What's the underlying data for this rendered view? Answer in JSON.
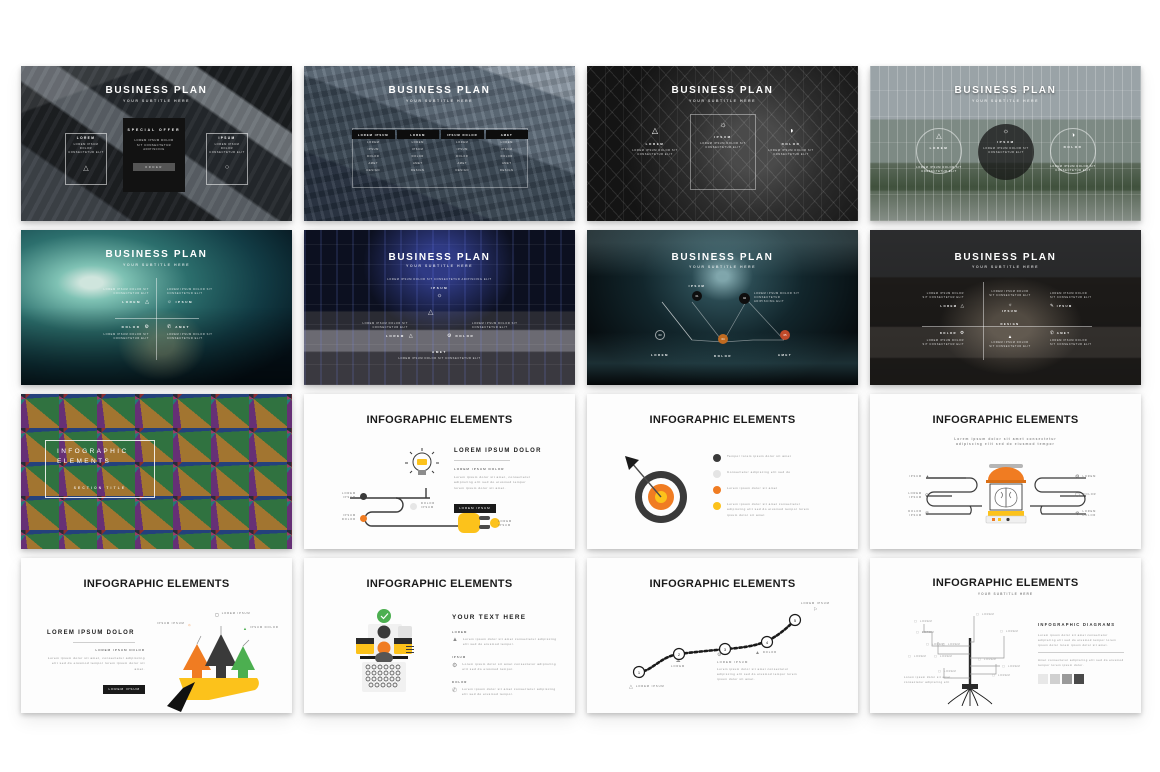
{
  "page": {
    "background": "#ffffff",
    "grid": {
      "rows": 4,
      "columns": 4,
      "total_slides": 16
    }
  },
  "palette": {
    "accent_orange": "#f07c22",
    "accent_yellow": "#fcc21b",
    "accent_dark": "#3a3a3a",
    "accent_grey": "#e0e0e0",
    "accent_green": "#4caf50",
    "text_dark": "#1a1a1a",
    "text_muted": "#8d8d8d"
  },
  "common": {
    "business_plan_title": "BUSINESS PLAN",
    "business_plan_subtitle": "YOUR SUBTITLE HERE",
    "infographic_title": "INFOGRAPHIC ELEMENTS",
    "lorem_ipsum": "LOREM IPSUM",
    "ipsum_dolor": "IPSUM DOLOR",
    "dolor_ipsum": "DOLOR IPSUM",
    "lorem": "LOREM",
    "ipsum": "IPSUM",
    "dolor": "DOLOR",
    "amet": "AMET",
    "sit": "SIT",
    "design": "DESIGN",
    "body_paragraph": "Lorem ipsum dolor sit amet, consectetur adipiscing elit sed do eiusmod tempor lorem ipsum dolor sit amet.",
    "body_short": "Lorem ipsum dolor sit amet consectetur adipiscing elit sed do eiusmod tempor."
  },
  "slides": [
    {
      "index": 1,
      "name": "business-plan-special-offer",
      "type": "photo-dark",
      "title": "BUSINESS PLAN",
      "subtitle": "YOUR SUBTITLE HERE",
      "card": {
        "heading": "SPECIAL OFFER",
        "body": "LOREM IPSUM DOLOR SIT CONSECTETUR ADIPISCING",
        "button": "ORDER"
      },
      "left_block": {
        "label": "LOREM",
        "body": "LOREM IPSUM DOLOR CONSECTETUR ELIT",
        "icon": "rocket-icon"
      },
      "right_block": {
        "label": "IPSUM",
        "body": "LOREM IPSUM DOLOR CONSECTETUR ELIT",
        "icon": "bulb-icon"
      }
    },
    {
      "index": 2,
      "name": "business-plan-pricing-table",
      "type": "photo-dark",
      "title": "BUSINESS PLAN",
      "subtitle": "YOUR SUBTITLE HERE",
      "table": {
        "headers": [
          "LOREM IPSUM",
          "LOREM",
          "IPSUM DOLOR",
          "AMET"
        ],
        "rows": [
          [
            "LOREM",
            "LOREM",
            "LOREM",
            "LOREM"
          ],
          [
            "IPSUM",
            "IPSUM",
            "IPSUM",
            "IPSUM"
          ],
          [
            "DOLOR",
            "DOLOR",
            "DOLOR",
            "DOLOR"
          ],
          [
            "AMET",
            "AMET",
            "AMET",
            "AMET"
          ],
          [
            "DESIGN",
            "DESIGN",
            "DESIGN",
            "DESIGN"
          ]
        ]
      }
    },
    {
      "index": 3,
      "name": "business-plan-three-icons-dome",
      "type": "photo-dark",
      "title": "BUSINESS PLAN",
      "subtitle": "YOUR SUBTITLE HERE",
      "columns": [
        {
          "icon": "rocket-icon",
          "label": "LOREM",
          "body": "LOREM IPSUM DOLOR SIT CONSECTETUR ELIT"
        },
        {
          "icon": "bulb-icon",
          "label": "IPSUM",
          "body": "LOREM IPSUM DOLOR SIT CONSECTETUR ELIT"
        },
        {
          "icon": "speedometer-icon",
          "label": "DOLOR",
          "body": "LOREM IPSUM DOLOR SIT CONSECTETUR ELIT"
        }
      ]
    },
    {
      "index": 4,
      "name": "business-plan-three-circles-glass",
      "type": "photo-light",
      "title": "BUSINESS PLAN",
      "subtitle": "YOUR SUBTITLE HERE",
      "columns": [
        {
          "icon": "rocket-icon",
          "label": "LOREM",
          "body": "LOREM IPSUM DOLOR SIT CONSECTETUR ELIT"
        },
        {
          "icon": "bulb-icon",
          "label": "IPSUM",
          "body": "LOREM IPSUM DOLOR SIT CONSECTETUR ELIT"
        },
        {
          "icon": "speedometer-icon",
          "label": "DOLOR",
          "body": "LOREM IPSUM DOLOR SIT CONSECTETUR ELIT"
        }
      ]
    },
    {
      "index": 5,
      "name": "business-plan-quadrant-bokeh",
      "type": "photo-dark",
      "title": "BUSINESS PLAN",
      "subtitle": "YOUR SUBTITLE HERE",
      "quadrants": [
        {
          "label": "LOREM",
          "body": "LOREM IPSUM DOLOR SIT CONSECTETUR ELIT",
          "icon": "rocket-icon",
          "align": "right"
        },
        {
          "label": "IPSUM",
          "body": "LOREM IPSUM DOLOR SIT CONSECTETUR ELIT",
          "icon": "bulb-icon",
          "align": "left"
        },
        {
          "label": "DOLOR",
          "body": "LOREM IPSUM DOLOR SIT CONSECTETUR ELIT",
          "icon": "gear-icon",
          "align": "right"
        },
        {
          "label": "AMET",
          "body": "LOREM IPSUM DOLOR SIT CONSECTETUR ELIT",
          "icon": "chat-icon",
          "align": "left"
        }
      ]
    },
    {
      "index": 6,
      "name": "business-plan-cross-atrium",
      "type": "photo-dark",
      "title": "BUSINESS PLAN",
      "subtitle": "YOUR SUBTITLE HERE",
      "nodes": [
        {
          "label": "IPSUM",
          "body": "LOREM IPSUM DOLOR SIT CONSECTETUR ADIPISCING ELIT",
          "icon": "bulb-icon",
          "position": "top"
        },
        {
          "label": "LOREM",
          "body": "LOREM IPSUM DOLOR SIT CONSECTETUR ELIT",
          "icon": "rocket-icon",
          "position": "left"
        },
        {
          "label": "DOLOR",
          "body": "LOREM IPSUM DOLOR SIT CONSECTETUR ELIT",
          "icon": "gear-icon",
          "position": "right"
        },
        {
          "label": "AMET",
          "body": "LOREM IPSUM DOLOR SIT CONSECTETUR ELIT",
          "icon": "chat-icon",
          "position": "bottom"
        }
      ]
    },
    {
      "index": 7,
      "name": "business-plan-numbered-nodes-tunnel",
      "type": "photo-dark",
      "title": "BUSINESS PLAN",
      "subtitle": "YOUR SUBTITLE HERE",
      "nodes": [
        {
          "number": "01",
          "label": "IPSUM",
          "body": ""
        },
        {
          "number": "02",
          "label": "",
          "body": "LOREM IPSUM DOLOR SIT CONSECTETUR ADIPISCING ELIT"
        },
        {
          "number": "03",
          "label": "LOREM",
          "body": ""
        },
        {
          "number": "04",
          "label": "DOLOR",
          "body": ""
        },
        {
          "number": "05",
          "label": "AMET",
          "body": ""
        }
      ]
    },
    {
      "index": 8,
      "name": "business-plan-six-blocks-portrait",
      "type": "photo-dark",
      "title": "BUSINESS PLAN",
      "subtitle": "YOUR SUBTITLE HERE",
      "blocks": [
        {
          "label": "LOREM",
          "body": "LOREM IPSUM DOLOR SIT CONSECTETUR ELIT",
          "icon": "rocket-icon"
        },
        {
          "label": "IPSUM",
          "body": "LOREM IPSUM DOLOR SIT CONSECTETUR ELIT",
          "icon": "bulb-icon"
        },
        {
          "label": "IPSUM",
          "body": "LOREM IPSUM DOLOR SIT CONSECTETUR ELIT",
          "icon": "pen-icon"
        },
        {
          "label": "DOLOR",
          "body": "LOREM IPSUM DOLOR SIT CONSECTETUR ELIT",
          "icon": "gear-icon"
        },
        {
          "label": "DESIGN",
          "body": "LOREM IPSUM DOLOR SIT CONSECTETUR ELIT",
          "icon": "chart-icon"
        },
        {
          "label": "AMET",
          "body": "LOREM IPSUM DOLOR SIT CONSECTETUR ELIT",
          "icon": "chat-icon"
        }
      ]
    },
    {
      "index": 9,
      "name": "infographic-section-divider-umbrellas",
      "type": "photo-color",
      "title_line1": "INFOGRAPHIC",
      "title_line2": "ELEMENTS",
      "subtitle": "SECTION TITLE"
    },
    {
      "index": 10,
      "name": "infographic-bulb-plug-flow",
      "type": "infographic",
      "title": "INFOGRAPHIC ELEMENTS",
      "heading": "LOREM IPSUM DOLOR",
      "subheading": "LOREM IPSUM DOLOR",
      "body": "Lorem ipsum dolor sit amet, consectetur adipiscing elit sed do eiusmod tempor lorem ipsum dolor sit amet.",
      "button": "LOREM IPSUM",
      "nodes": [
        {
          "label": "LOREM IPSUM",
          "color": "#3a3a3a",
          "icon": "gear-icon"
        },
        {
          "label": "IPSUM DOLOR",
          "color": "#f07c22",
          "icon": "target-icon"
        },
        {
          "label": "DOLOR IPSUM",
          "color": "#e0e0e0",
          "icon": "cloud-icon"
        },
        {
          "label": "LOREM IPSUM",
          "color": "#fcc21b",
          "icon": "bulb-icon"
        }
      ],
      "graphics": [
        "lightbulb-icon",
        "power-plug-icon"
      ]
    },
    {
      "index": 11,
      "name": "infographic-target-dart-list",
      "type": "infographic",
      "title": "INFOGRAPHIC ELEMENTS",
      "graphics": [
        "dartboard-icon",
        "dart-arrow-icon"
      ],
      "items": [
        {
          "color": "#3a3a3a",
          "text": "Tempor lorem ipsum dolor sit amet"
        },
        {
          "color": "#e0e0e0",
          "text": "Consectetur adipiscing elit sed do"
        },
        {
          "color": "#f07c22",
          "text": "Lorem ipsum dolor sit amet"
        },
        {
          "color": "#fcc21b",
          "text": "Lorem ipsum dolor sit amet consectetur adipiscing elit sed do eiusmod tempor lorem ipsum dolor sit amet"
        }
      ]
    },
    {
      "index": 12,
      "name": "infographic-brain-machine-pipes",
      "type": "infographic",
      "title": "INFOGRAPHIC ELEMENTS",
      "subtitle": "Lorem ipsum dolor sit amet consectetur adipiscing elit sed do eiusmod tempor",
      "left_items": [
        {
          "label": "IPSUM",
          "icon": "chart-icon"
        },
        {
          "label": "LOREM IPSUM",
          "icon": "search-icon"
        },
        {
          "label": "DOLOR IPSUM",
          "icon": "chat-icon"
        }
      ],
      "right_items": [
        {
          "label": "LOREM",
          "icon": "gear-icon"
        },
        {
          "label": "DOLOR",
          "icon": "cart-icon"
        },
        {
          "label": "LOREM DOLOR",
          "icon": "gear-icon"
        }
      ],
      "graphics": [
        "brain-machine-icon"
      ]
    },
    {
      "index": 13,
      "name": "infographic-hand-arrows",
      "type": "infographic",
      "title": "INFOGRAPHIC ELEMENTS",
      "heading": "LOREM IPSUM DOLOR",
      "subheading": "LOREM IPSUM DOLOR",
      "body": "Lorem ipsum dolor sit amet, consectetur adipiscing elit sed do eiusmod tempor lorem ipsum dolor sit amet.",
      "button": "LOREM IPSUM",
      "callouts": [
        {
          "label": "IPSUM IPSUM",
          "color": "#f07c22",
          "icon": "bulb-icon"
        },
        {
          "label": "LOREM IPSUM",
          "color": "#3a3a3a",
          "icon": "monitor-icon"
        },
        {
          "label": "IPSUM DOLOR",
          "color": "#4caf50",
          "icon": "chart-icon"
        }
      ],
      "graphics": [
        "hand-icon",
        "arrow-up-icon"
      ]
    },
    {
      "index": 14,
      "name": "infographic-typewriter-list",
      "type": "infographic",
      "title": "INFOGRAPHIC ELEMENTS",
      "heading": "YOUR TEXT HERE",
      "items": [
        {
          "label": "LOREM",
          "text": "Lorem ipsum dolor sit amet consectetur adipiscing elit sed do eiusmod tempor.",
          "icon": "chart-icon"
        },
        {
          "label": "IPSUM",
          "text": "Lorem ipsum dolor sit amet consectetur adipiscing elit sed do eiusmod tempor.",
          "icon": "gear-icon"
        },
        {
          "label": "DOLOR",
          "text": "Lorem ipsum dolor sit amet consectetur adipiscing elit sed do eiusmod tempor.",
          "icon": "chat-icon"
        }
      ],
      "graphics": [
        "typewriter-icon"
      ],
      "badges": [
        "#4caf50",
        "#3a3a3a",
        "#f07c22",
        "#fcc21b"
      ]
    },
    {
      "index": 15,
      "name": "infographic-curve-timeline",
      "type": "infographic",
      "title": "INFOGRAPHIC ELEMENTS",
      "steps": [
        {
          "number": "1",
          "label": "LOREM IPSUM",
          "icon": "rocket-icon",
          "body": ""
        },
        {
          "number": "2",
          "label": "LOREM",
          "icon": "cloud-icon",
          "body": ""
        },
        {
          "number": "3",
          "label": "LOREM IPSUM",
          "icon": "gear-icon",
          "body": "Lorem ipsum dolor sit amet consectetur adipiscing elit sed do eiusmod tempor lorem ipsum dolor sit amet."
        },
        {
          "number": "4",
          "label": "DOLOR",
          "icon": "chart-icon",
          "body": ""
        },
        {
          "number": "5",
          "label": "LOREM IPSUM",
          "icon": "flag-icon",
          "body": ""
        }
      ]
    },
    {
      "index": 16,
      "name": "infographic-tree-diagram",
      "type": "infographic",
      "title": "INFOGRAPHIC ELEMENTS",
      "subtitle": "YOUR SUBTITLE HERE",
      "panel": {
        "heading": "INFOGRAPHIC DIAGRAMS",
        "body": "Lorem ipsum dolor sit amet consectetur adipiscing elit sed do eiusmod tempor lorem ipsum dolor lorem ipsum dolor sit amet.",
        "body2": "Amet consectetur adipiscing elit sed do eiusmod tempor lorem ipsum dolor.",
        "swatches": [
          "#e8e8e8",
          "#d0d0d0",
          "#9a9a9a",
          "#4a4a4a"
        ]
      },
      "branch_labels": [
        "LOREM",
        "LOREM",
        "LOREM",
        "LOREM",
        "LOREM",
        "LOREM",
        "LOREM",
        "LOREM",
        "LOREM",
        "LOREM",
        "LOREM",
        "LOREM"
      ],
      "note": "Lorem ipsum dolor sit amet, consectetur adipiscing elit",
      "graphics": [
        "tree-roots-icon"
      ]
    }
  ]
}
